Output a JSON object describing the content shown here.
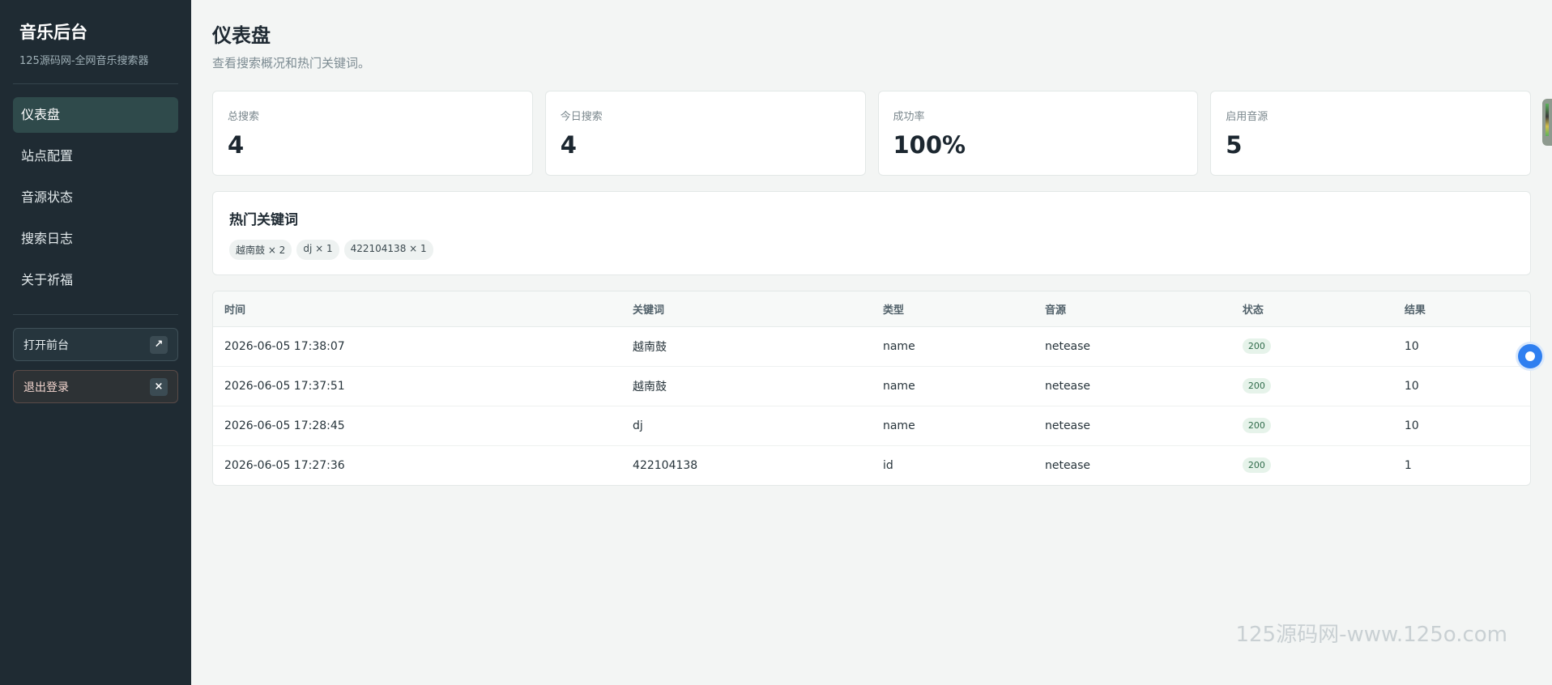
{
  "sidebar": {
    "title": "音乐后台",
    "subtitle": "125源码网-全网音乐搜索器",
    "items": [
      {
        "label": "仪表盘",
        "active": true
      },
      {
        "label": "站点配置",
        "active": false
      },
      {
        "label": "音源状态",
        "active": false
      },
      {
        "label": "搜索日志",
        "active": false
      },
      {
        "label": "关于祈福",
        "active": false
      }
    ],
    "open_frontend": {
      "label": "打开前台",
      "icon": "↗"
    },
    "logout": {
      "label": "退出登录",
      "icon": "×"
    }
  },
  "header": {
    "title": "仪表盘",
    "subtitle": "查看搜索概况和热门关键词。"
  },
  "stats": [
    {
      "label": "总搜索",
      "value": "4"
    },
    {
      "label": "今日搜索",
      "value": "4"
    },
    {
      "label": "成功率",
      "value": "100%"
    },
    {
      "label": "启用音源",
      "value": "5"
    }
  ],
  "keywords": {
    "title": "热门关键词",
    "tags": [
      "越南鼓 × 2",
      "dj × 1",
      "422104138 × 1"
    ]
  },
  "table": {
    "columns": [
      "时间",
      "关键词",
      "类型",
      "音源",
      "状态",
      "结果"
    ],
    "rows": [
      [
        "2026-06-05 17:38:07",
        "越南鼓",
        "name",
        "netease",
        "200",
        "10"
      ],
      [
        "2026-06-05 17:37:51",
        "越南鼓",
        "name",
        "netease",
        "200",
        "10"
      ],
      [
        "2026-06-05 17:28:45",
        "dj",
        "name",
        "netease",
        "200",
        "10"
      ],
      [
        "2026-06-05 17:27:36",
        "422104138",
        "id",
        "netease",
        "200",
        "1"
      ]
    ]
  },
  "watermark": "125源码网-www.125o.com",
  "colors": {
    "sidebar_bg": "#1f2b33",
    "active_nav_bg": "#2f4a4b",
    "status_ok": "#2f6b4a",
    "float_button": "#2f7ff0"
  }
}
